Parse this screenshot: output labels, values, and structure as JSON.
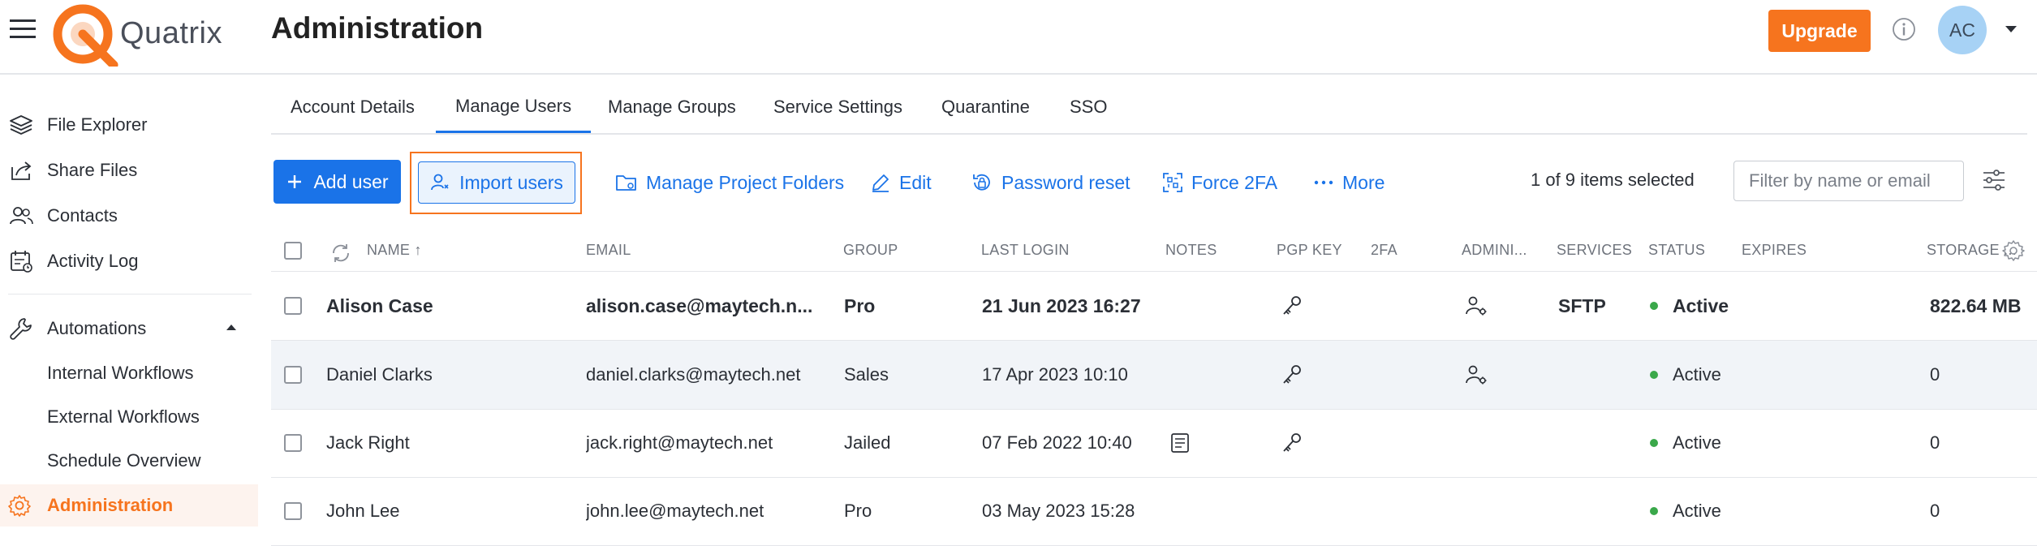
{
  "app": {
    "brand": "Quatrix",
    "page_title": "Administration",
    "upgrade_label": "Upgrade",
    "avatar_initials": "AC",
    "brand_color": "#f6741e",
    "accent_color": "#1a73e8"
  },
  "sidebar": {
    "items": [
      {
        "label": "File Explorer",
        "icon": "layers-icon"
      },
      {
        "label": "Share Files",
        "icon": "share-icon"
      },
      {
        "label": "Contacts",
        "icon": "contacts-icon"
      },
      {
        "label": "Activity Log",
        "icon": "activity-log-icon"
      },
      {
        "label": "Automations",
        "icon": "wrench-icon"
      },
      {
        "label": "Administration",
        "icon": "gear-icon"
      }
    ],
    "automations_sub": [
      "Internal Workflows",
      "External Workflows",
      "Schedule Overview"
    ]
  },
  "tabs": [
    "Account Details",
    "Manage Users",
    "Manage Groups",
    "Service Settings",
    "Quarantine",
    "SSO"
  ],
  "toolbar": {
    "add_user": "Add user",
    "import_users": "Import users",
    "manage_project_folders": "Manage Project Folders",
    "edit": "Edit",
    "password_reset": "Password reset",
    "force_2fa": "Force 2FA",
    "more": "More",
    "selected_count": "1 of 9 items selected",
    "filter_placeholder": "Filter by name or email"
  },
  "table": {
    "columns": [
      "NAME",
      "EMAIL",
      "GROUP",
      "LAST LOGIN",
      "NOTES",
      "PGP KEY",
      "2FA",
      "ADMINI...",
      "SERVICES",
      "STATUS",
      "EXPIRES",
      "STORAGE ..."
    ],
    "rows": [
      {
        "name": "Alison Case",
        "email": "alison.case@maytech.n...",
        "group": "Pro",
        "last_login": "21 Jun 2023 16:27",
        "notes": false,
        "pgp": true,
        "admin": true,
        "services": "SFTP",
        "status": "Active",
        "expires": "",
        "storage": "822.64 MB",
        "selected": true
      },
      {
        "name": "Daniel Clarks",
        "email": "daniel.clarks@maytech.net",
        "group": "Sales",
        "last_login": "17 Apr 2023 10:10",
        "notes": false,
        "pgp": true,
        "admin": true,
        "services": "",
        "status": "Active",
        "expires": "",
        "storage": "0",
        "selected": false
      },
      {
        "name": "Jack Right",
        "email": "jack.right@maytech.net",
        "group": "Jailed",
        "last_login": "07 Feb 2022 10:40",
        "notes": true,
        "pgp": true,
        "admin": false,
        "services": "",
        "status": "Active",
        "expires": "",
        "storage": "0",
        "selected": false
      },
      {
        "name": "John Lee",
        "email": "john.lee@maytech.net",
        "group": "Pro",
        "last_login": "03 May 2023 15:28",
        "notes": false,
        "pgp": false,
        "admin": false,
        "services": "",
        "status": "Active",
        "expires": "",
        "storage": "0",
        "selected": false
      }
    ]
  }
}
